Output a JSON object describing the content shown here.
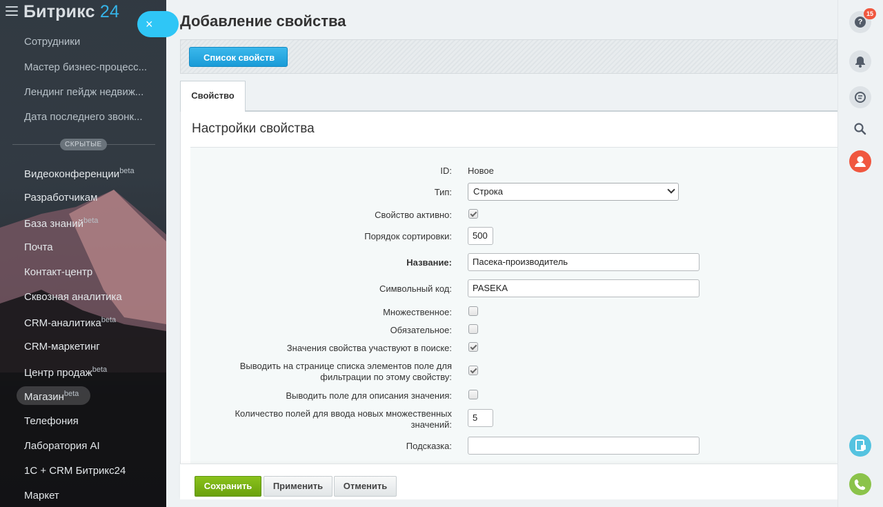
{
  "sidebar": {
    "logo_main": "Битрикс",
    "logo_num": "24",
    "close_glyph": "×",
    "items": [
      {
        "label": "Сотрудники",
        "beta": ""
      },
      {
        "label": "Мастер бизнес-процесс...",
        "beta": ""
      },
      {
        "label": "Лендинг пейдж недвиж...",
        "beta": ""
      },
      {
        "label": "Дата последнего звонк...",
        "beta": ""
      },
      {
        "label": "Видеоконференции",
        "beta": "beta"
      },
      {
        "label": "Разработчикам",
        "beta": ""
      },
      {
        "label": "База знаний",
        "beta": "beta"
      },
      {
        "label": "Почта",
        "beta": ""
      },
      {
        "label": "Контакт-центр",
        "beta": ""
      },
      {
        "label": "Сквозная аналитика",
        "beta": ""
      },
      {
        "label": "CRM-аналитика",
        "beta": "beta"
      },
      {
        "label": "CRM-маркетинг",
        "beta": ""
      },
      {
        "label": "Центр продаж",
        "beta": "beta"
      },
      {
        "label": "Магазин",
        "beta": "beta"
      },
      {
        "label": "Телефония",
        "beta": ""
      },
      {
        "label": "Лаборатория AI",
        "beta": ""
      },
      {
        "label": "1С + CRM Битрикс24",
        "beta": ""
      },
      {
        "label": "Маркет",
        "beta": ""
      }
    ],
    "hidden_label": "СКРЫТЫЕ"
  },
  "header": {
    "title": "Добавление свойства"
  },
  "toolbar": {
    "list_button": "Список свойств"
  },
  "tabs": [
    {
      "label": "Свойство"
    }
  ],
  "form": {
    "section_title": "Настройки свойства",
    "id_label": "ID:",
    "id_value": "Новое",
    "type_label": "Тип:",
    "type_value": "Строка",
    "active_label": "Свойство активно:",
    "active_checked": true,
    "sort_label": "Порядок сортировки:",
    "sort_value": "500",
    "name_label": "Название:",
    "name_value": "Пасека-производитель",
    "code_label": "Символьный код:",
    "code_value": "PASEKA",
    "multiple_label": "Множественное:",
    "multiple_checked": false,
    "required_label": "Обязательное:",
    "required_checked": false,
    "search_label": "Значения свойства участвуют в поиске:",
    "search_checked": true,
    "filter_label_1": "Выводить на странице списка элементов поле для",
    "filter_label_2": "фильтрации по этому свойству:",
    "filter_checked": true,
    "desc_label": "Выводить поле для описания значения:",
    "desc_checked": false,
    "count_label_1": "Количество полей для ввода новых множественных",
    "count_label_2": "значений:",
    "count_value": "5",
    "hint_label": "Подсказка:",
    "hint_value": ""
  },
  "footer": {
    "save": "Сохранить",
    "apply": "Применить",
    "cancel": "Отменить"
  },
  "right_panel": {
    "help_badge": "15",
    "help_glyph": "?"
  },
  "colors": {
    "accent": "#2fc6f6",
    "save_green": "#7bb315",
    "notify_red": "#f0573f"
  }
}
